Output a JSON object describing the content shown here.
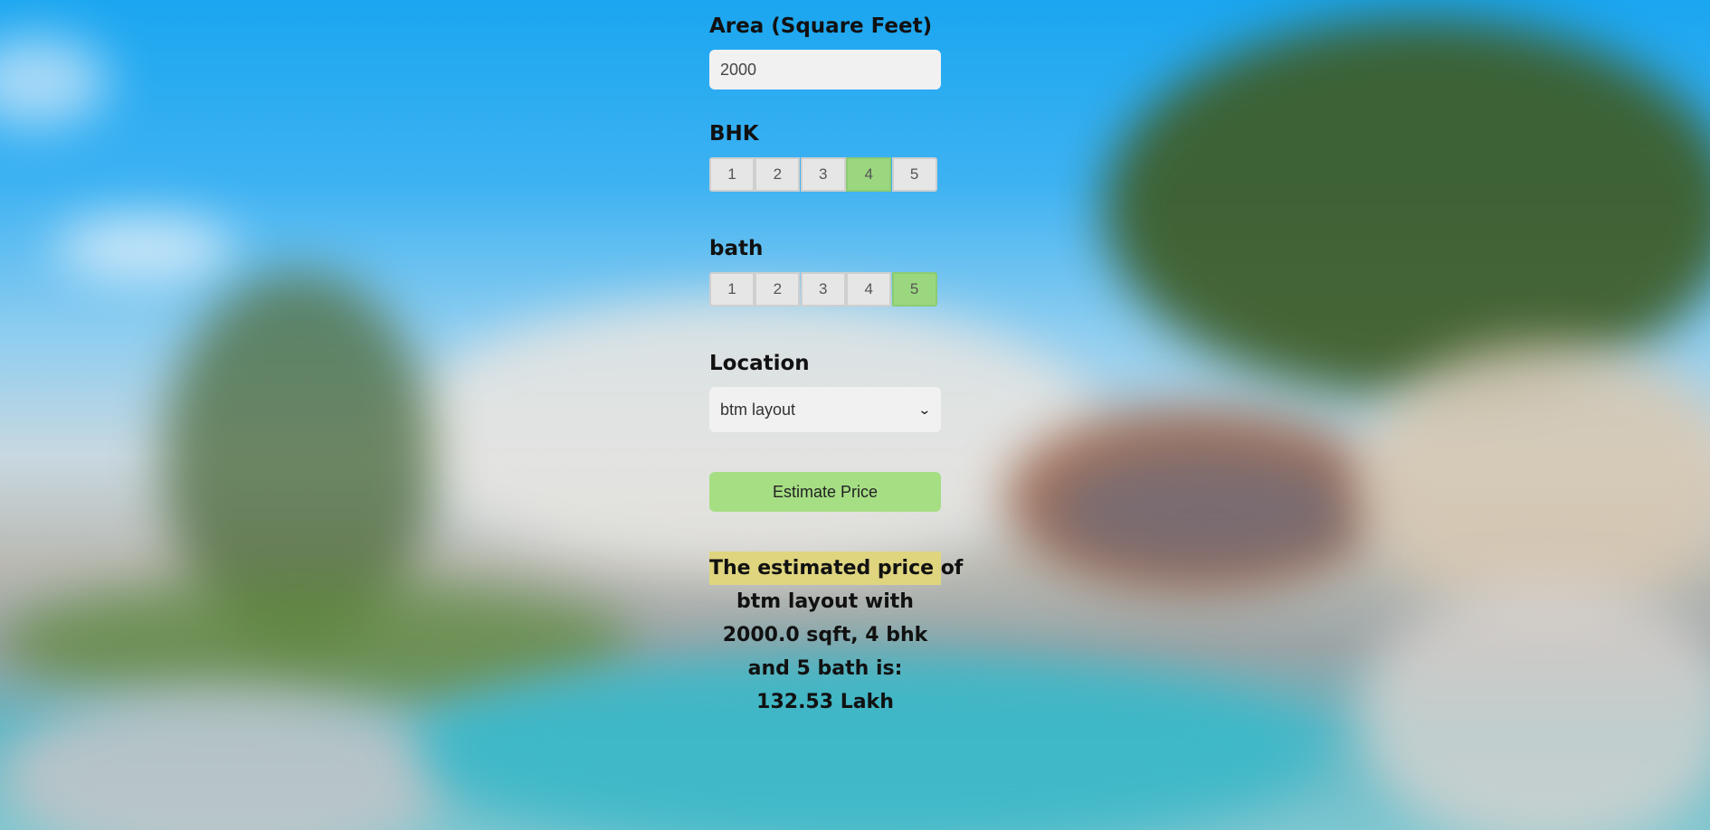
{
  "form": {
    "area_label": "Area (Square Feet)",
    "area_value": "2000",
    "bhk_label": "BHK",
    "bhk_options": [
      "1",
      "2",
      "3",
      "4",
      "5"
    ],
    "bhk_selected": "4",
    "bath_label": "bath",
    "bath_options": [
      "1",
      "2",
      "3",
      "4",
      "5"
    ],
    "bath_selected": "5",
    "location_label": "Location",
    "location_selected": "btm layout",
    "estimate_button": "Estimate Price"
  },
  "result": {
    "line1": "The estimated price of",
    "rest": "btm layout with 2000.0 sqft, 4 bhk and 5 bath is: 132.53 Lakh"
  },
  "colors": {
    "selected_option": "#9bd77f",
    "button": "#a6de84",
    "result_highlight": "#dfd57f"
  },
  "icons": {
    "select_arrow": "chevron-down-icon"
  }
}
